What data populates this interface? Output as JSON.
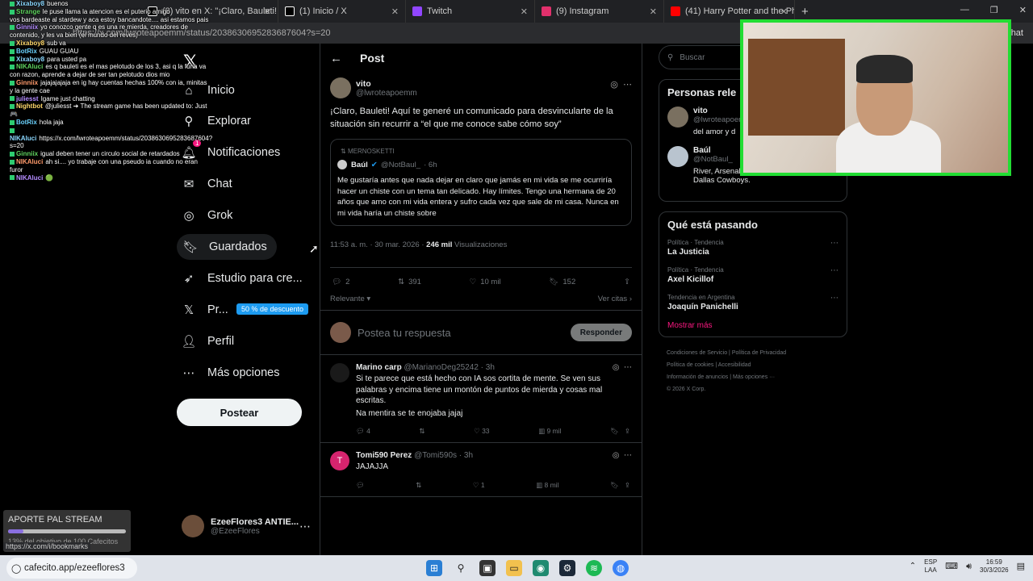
{
  "browser": {
    "tabs": [
      {
        "label": "(8) vito en X: \"¡Claro, Bauleti! Aquí",
        "color": "#ffffff"
      },
      {
        "label": "(1) Inicio / X",
        "color": "#ffffff"
      },
      {
        "label": "Twitch",
        "color": "#9146ff"
      },
      {
        "label": "(9) Instagram",
        "color": "#e1306c"
      },
      {
        "label": "(41) Harry Potter and the Philosoph",
        "color": "#ff0000"
      }
    ],
    "url": "https://x.com/lwroteapoemm/status/2038630695283687604?s=20",
    "chat_tab": "Chat"
  },
  "chat": [
    {
      "user": "Xixaboy8",
      "text": "buenos"
    },
    {
      "user": "Strange",
      "text": "le puse llama la atencion es el puterio amigo"
    },
    {
      "user": "",
      "text": "vos bardeaste al stardew y aca estoy bancandote.... asi estamos pais"
    },
    {
      "user": "Ginniix",
      "text": "yo conozco gente q es una re mierda, creadores de contenido, y les va bien (el mundo del reves)"
    },
    {
      "user": "Xixaboy8",
      "text": "sub va"
    },
    {
      "user": "BotRix",
      "text": "GUAU GUAU"
    },
    {
      "user": "Xixaboy8",
      "text": "para usted pa"
    },
    {
      "user": "NIKAluci",
      "text": "es q bauleti es el mas pelotudo de los 3, asi q la funa va con razon, aprende a dejar de ser tan pelotudo dios mio"
    },
    {
      "user": "Ginniix",
      "text": "jajajajajaja en ig hay cuentas hechas 100% con ia, minitas y la gente cae"
    },
    {
      "user": "juliesst",
      "text": "Igame just chatting"
    },
    {
      "user": "Nightbot",
      "text": "@juliesst ➔ The stream game has been updated to: Just 🎮"
    },
    {
      "user": "BotRix",
      "text": "hola jaja"
    },
    {
      "user": "NIKAluci",
      "text": "https://x.com/lwroteapoemm/status/2038630695283687604?s=20"
    },
    {
      "user": "Ginniix",
      "text": "igual deben tener un circulo social de retardados"
    },
    {
      "user": "NIKAluci",
      "text": "ah si.... yo trabaje con una pseudo ia cuando no eran furor"
    },
    {
      "user": "NIKAluci",
      "text": "🟢"
    }
  ],
  "nav": {
    "items": [
      {
        "icon": "home-icon",
        "glyph": "⌂",
        "label": "Inicio"
      },
      {
        "icon": "search-icon",
        "glyph": "⚲",
        "label": "Explorar"
      },
      {
        "icon": "bell-icon",
        "glyph": "🔔︎",
        "label": "Notificaciones"
      },
      {
        "icon": "chat-icon",
        "glyph": "✉",
        "label": "Chat"
      },
      {
        "icon": "grok-icon",
        "glyph": "◎",
        "label": "Grok"
      },
      {
        "icon": "bookmark-icon",
        "glyph": "🔖︎",
        "label": "Guardados"
      },
      {
        "icon": "rocket-icon",
        "glyph": "➶",
        "label": "Estudio para cre..."
      },
      {
        "icon": "premium-x-icon",
        "glyph": "𝕏",
        "label": "Pr..."
      },
      {
        "icon": "user-icon",
        "glyph": "👤︎",
        "label": "Perfil"
      },
      {
        "icon": "more-icon",
        "glyph": "⋯",
        "label": "Más opciones"
      }
    ],
    "notif_badge": "1",
    "promo": "50 % de descuento",
    "post_button": "Postear",
    "me": {
      "name": "EzeeFlores3 ANTIE...",
      "handle": "@EzeeFlores"
    }
  },
  "main": {
    "header": "Post",
    "post": {
      "name": "vito",
      "handle": "@lwroteapoemm",
      "text": "¡Claro, Bauleti! Aquí te generé un comunicado para desvincularte de la situación sin recurrir a “el que me conoce sabe cómo soy”",
      "quote": {
        "repost_label": "MERNOSKETTI",
        "name": "Baúl",
        "handle": "@NotBaul_",
        "time": "· 6h",
        "text": "Me gustaría antes que nada dejar en claro que jamás en mi vida se me ocurriría hacer un chiste con un tema tan delicado. Hay límites. Tengo una hermana de 20 años que amo con mi vida entera y sufro cada vez que sale de mi casa. Nunca en mi vida haría un chiste sobre"
      },
      "time_date": "11:53 a. m. · 30 mar. 2026 ·",
      "views": "246 mil",
      "views_label": "Visualizaciones",
      "stats": {
        "replies": "2",
        "reposts": "391",
        "likes": "10 mil",
        "bookmarks": "152"
      },
      "sort": "Relevante",
      "quotes_link": "Ver citas"
    },
    "reply_placeholder": "Postea tu respuesta",
    "reply_button": "Responder",
    "comments": [
      {
        "name": "Marino carp",
        "handle": "@MarianoDeg25242 · 3h",
        "avatar_color": "#1a1a1a",
        "lines": [
          "Si te parece que está hecho con IA sos cortita de mente. Se ven sus palabras y encima tiene un montón de puntos de mierda y cosas mal escritas.",
          "Na mentira se te enojaba jajaj"
        ],
        "stats": {
          "replies": "4",
          "reposts": "",
          "likes": "33",
          "views": "9 mil"
        }
      },
      {
        "name": "Tomi590 Perez",
        "handle": "@Tomi590s · 3h",
        "avatar_color": "#d6246e",
        "avatar_letter": "T",
        "lines": [
          "JAJAJJA"
        ],
        "stats": {
          "replies": "",
          "reposts": "",
          "likes": "1",
          "views": "8 mil"
        }
      }
    ]
  },
  "right": {
    "search_placeholder": "Buscar",
    "people_title": "Personas rele",
    "people": [
      {
        "name": "vito",
        "handle": "@lwroteapoem",
        "desc": "del amor y d",
        "color": "#7a7060"
      },
      {
        "name": "Baúl",
        "handle": "@NotBaul_",
        "desc": "River, Arsenal FC, San Antonio Spurs y Dallas Cowboys.",
        "color": "#b9c4cf"
      }
    ],
    "trends_title": "Qué está pasando",
    "trends": [
      {
        "cat": "Política · Tendencia",
        "topic": "La Justicia"
      },
      {
        "cat": "Política · Tendencia",
        "topic": "Axel Kicillof"
      },
      {
        "cat": "Tendencia en Argentina",
        "topic": "Joaquín Panichelli"
      }
    ],
    "show_more": "Mostrar más",
    "footer": [
      "Condiciones de Servicio",
      "Política de Privacidad",
      "Política de cookies",
      "Accesibilidad",
      "Información de anuncios",
      "Más opciones ···",
      "© 2026 X Corp."
    ]
  },
  "donation": {
    "title": "APORTE PAL STREAM",
    "subtitle": "13% del objetivo de 100 Cafecitos",
    "progress": 0.13
  },
  "status_url": "https://x.com/i/bookmarks",
  "taskbar": {
    "search_text": "cafecito.app/ezeeflores3",
    "lang": "ESP",
    "lang2": "LAA",
    "time": "16:59",
    "date": "30/3/2026"
  }
}
